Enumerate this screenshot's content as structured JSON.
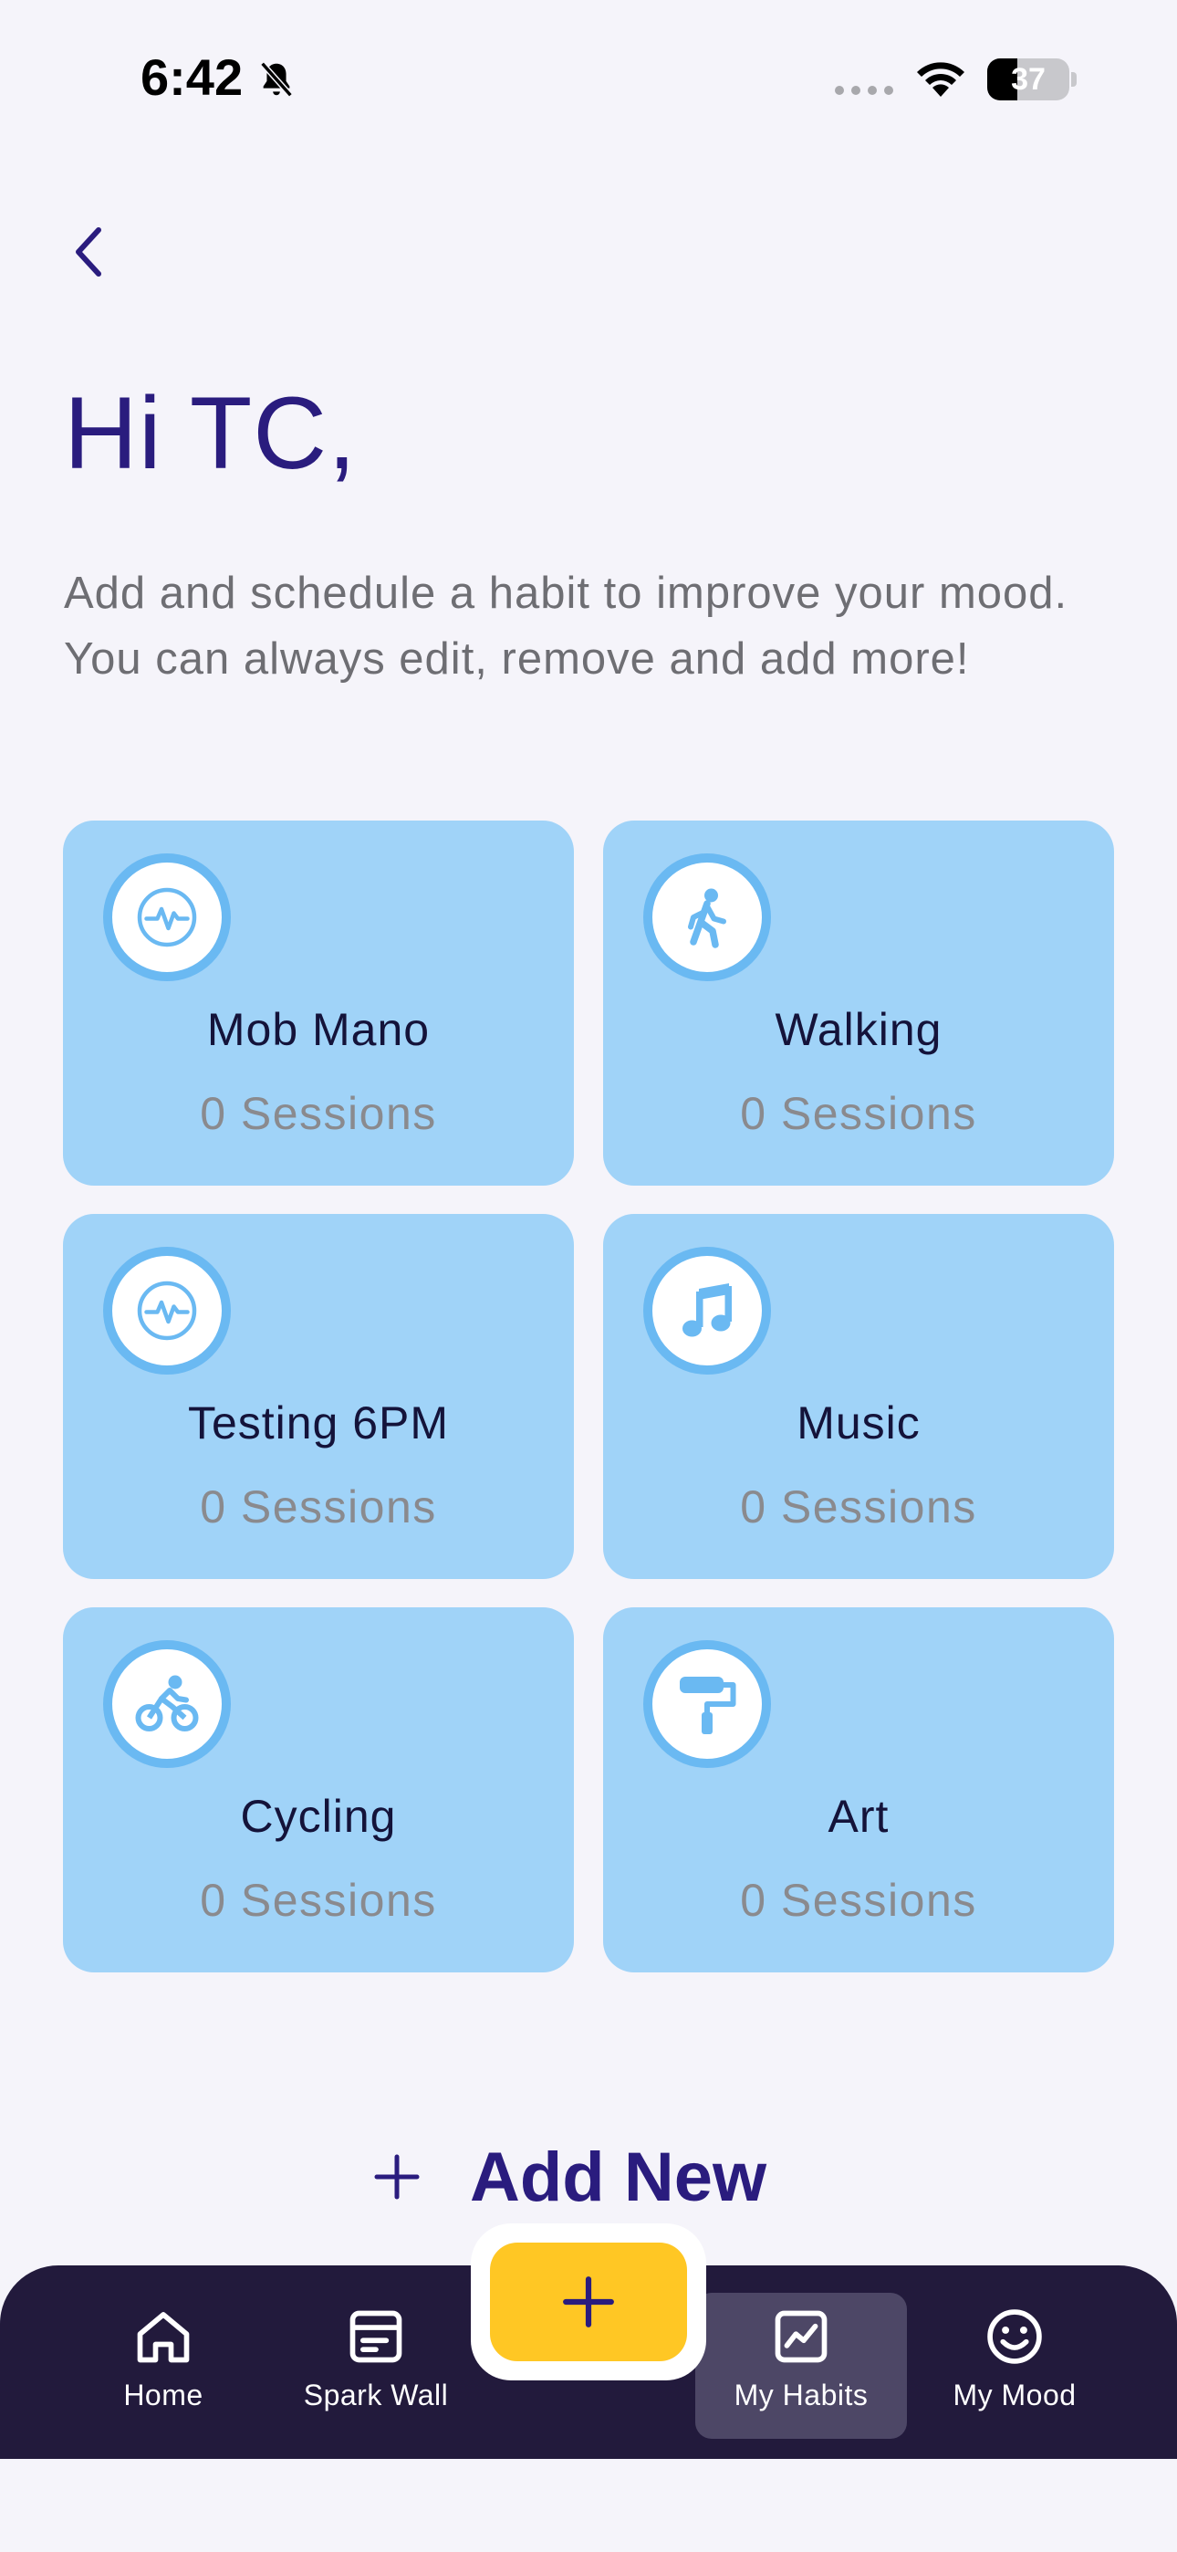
{
  "status_bar": {
    "time": "6:42",
    "battery_percent": "37",
    "battery_level": 0.37
  },
  "header": {
    "greeting": "Hi TC,",
    "intro": "Add and schedule a habit to improve your mood. You can always edit, remove and add more!"
  },
  "habits": [
    {
      "name": "Mob Mano",
      "sessions": "0 Sessions",
      "icon": "activity-pulse-icon"
    },
    {
      "name": "Walking",
      "sessions": "0 Sessions",
      "icon": "walking-person-icon"
    },
    {
      "name": "Testing 6PM",
      "sessions": "0 Sessions",
      "icon": "activity-pulse-icon"
    },
    {
      "name": "Music",
      "sessions": "0 Sessions",
      "icon": "music-note-icon"
    },
    {
      "name": "Cycling",
      "sessions": "0 Sessions",
      "icon": "cyclist-icon"
    },
    {
      "name": "Art",
      "sessions": "0 Sessions",
      "icon": "paint-roller-icon"
    }
  ],
  "add_new": {
    "label": "Add New"
  },
  "nav": {
    "items": [
      {
        "label": "Home",
        "icon": "home-icon"
      },
      {
        "label": "Spark Wall",
        "icon": "spark-wall-icon"
      },
      {
        "label": "My Habits",
        "icon": "chart-line-icon",
        "active": true
      },
      {
        "label": "My Mood",
        "icon": "smiley-icon"
      }
    ],
    "fab_icon": "plus-icon"
  },
  "colors": {
    "background": "#f5f4fa",
    "accent": "#2a1c7e",
    "card": "#a0d3f8",
    "icon_ring": "#6ab9f2",
    "nav_bg": "#221a3c",
    "fab": "#ffc724"
  }
}
